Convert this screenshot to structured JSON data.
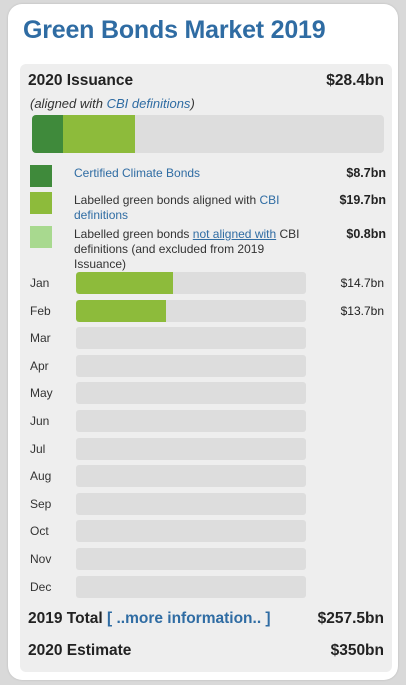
{
  "title": "Green Bonds Market 2019",
  "issuance": {
    "label": "2020 Issuance",
    "value": "$28.4bn",
    "subtitle_prefix": "(aligned with ",
    "subtitle_link": "CBI definitions",
    "subtitle_suffix": ")"
  },
  "legend": [
    {
      "label_html_parts": [
        "Certified Climate Bonds"
      ],
      "value": "$8.7bn",
      "color": "#3f8a3b"
    },
    {
      "label_html_parts": [
        "Labelled green bonds aligned with ",
        "CBI definitions"
      ],
      "value": "$19.7bn",
      "color": "#8dbb3b"
    },
    {
      "label_html_parts": [
        "Labelled green bonds ",
        "not aligned with",
        " CBI definitions (and excluded from 2019 Issuance)"
      ],
      "value": "$0.8bn",
      "color": "#a8d98f"
    }
  ],
  "months": [
    {
      "label": "Jan",
      "value": "$14.7bn"
    },
    {
      "label": "Feb",
      "value": "$13.7bn"
    },
    {
      "label": "Mar",
      "value": ""
    },
    {
      "label": "Apr",
      "value": ""
    },
    {
      "label": "May",
      "value": ""
    },
    {
      "label": "Jun",
      "value": ""
    },
    {
      "label": "Jul",
      "value": ""
    },
    {
      "label": "Aug",
      "value": ""
    },
    {
      "label": "Sep",
      "value": ""
    },
    {
      "label": "Oct",
      "value": ""
    },
    {
      "label": "Nov",
      "value": ""
    },
    {
      "label": "Dec",
      "value": ""
    }
  ],
  "footer": {
    "total_label": "2019 Total",
    "more_info": "[ ..more information.. ]",
    "total_value": "$257.5bn",
    "estimate_label": "2020 Estimate",
    "estimate_value": "$350bn"
  },
  "chart_data": [
    {
      "type": "bar",
      "orientation": "horizontal-stacked",
      "categories": [
        "2020 Issuance"
      ],
      "series": [
        {
          "name": "Certified Climate Bonds",
          "values": [
            8.7
          ]
        },
        {
          "name": "Labelled green bonds aligned with CBI definitions",
          "values": [
            19.7
          ]
        }
      ],
      "xlim": [
        0,
        350
      ]
    },
    {
      "type": "bar",
      "orientation": "horizontal",
      "categories": [
        "Jan",
        "Feb",
        "Mar",
        "Apr",
        "May",
        "Jun",
        "Jul",
        "Aug",
        "Sep",
        "Oct",
        "Nov",
        "Dec"
      ],
      "values": [
        14.7,
        13.7,
        0,
        0,
        0,
        0,
        0,
        0,
        0,
        0,
        0,
        0
      ],
      "xlim": [
        0,
        35
      ]
    }
  ]
}
